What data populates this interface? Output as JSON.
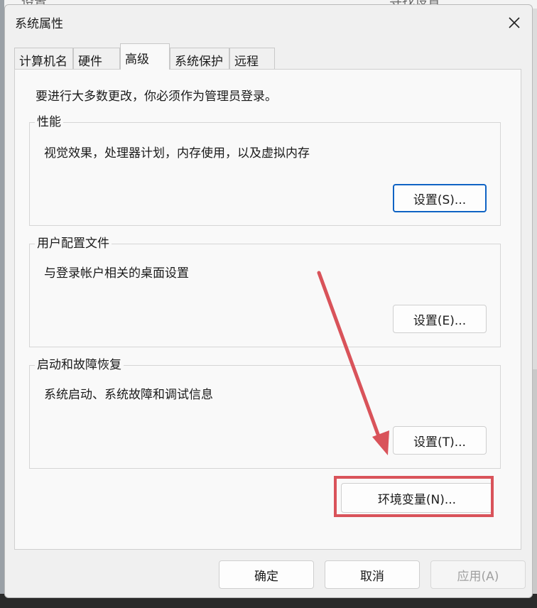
{
  "background": {
    "title": "设置",
    "search": "寻找设置"
  },
  "dialog": {
    "title": "系统属性",
    "close_glyph": "✕",
    "tabs": [
      {
        "label": "计算机名",
        "active": false
      },
      {
        "label": "硬件",
        "active": false
      },
      {
        "label": "高级",
        "active": true
      },
      {
        "label": "系统保护",
        "active": false
      },
      {
        "label": "远程",
        "active": false
      }
    ],
    "notice": "要进行大多数更改，你必须作为管理员登录。",
    "performance": {
      "label": "性能",
      "description": "视觉效果，处理器计划，内存使用，以及虚拟内存",
      "button": "设置(S)..."
    },
    "user_profiles": {
      "label": "用户配置文件",
      "description": "与登录帐户相关的桌面设置",
      "button": "设置(E)..."
    },
    "startup_recovery": {
      "label": "启动和故障恢复",
      "description": "系统启动、系统故障和调试信息",
      "button": "设置(T)..."
    },
    "env_button": "环境变量(N)...",
    "footer": {
      "ok": "确定",
      "cancel": "取消",
      "apply": "应用(A)"
    }
  },
  "annotation": {
    "color": "#d9535a",
    "marks": [
      "arrow-icon",
      "highlight-box"
    ]
  }
}
